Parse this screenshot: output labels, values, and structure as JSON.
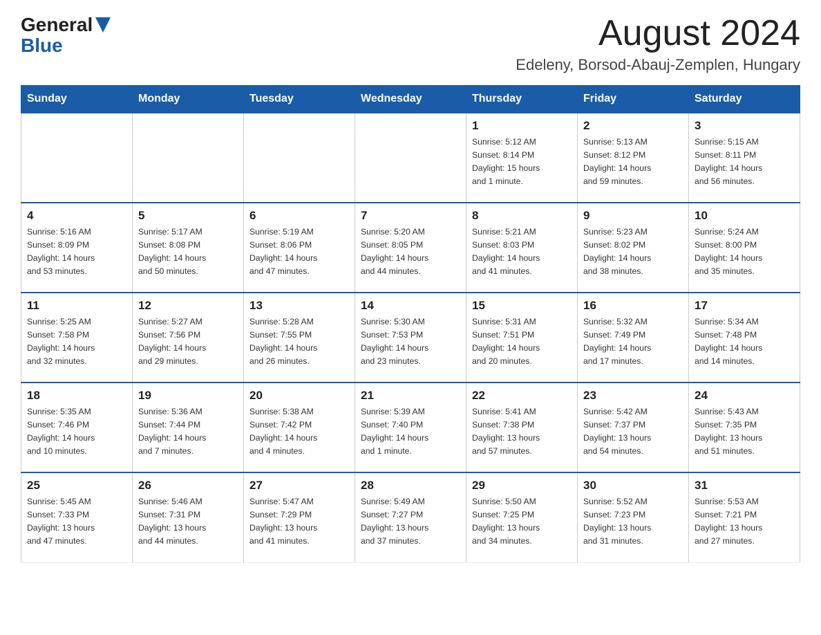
{
  "header": {
    "logo_general": "General",
    "logo_blue": "Blue",
    "month_title": "August 2024",
    "location": "Edeleny, Borsod-Abauj-Zemplen, Hungary"
  },
  "weekdays": [
    "Sunday",
    "Monday",
    "Tuesday",
    "Wednesday",
    "Thursday",
    "Friday",
    "Saturday"
  ],
  "weeks": [
    [
      {
        "day": "",
        "info": ""
      },
      {
        "day": "",
        "info": ""
      },
      {
        "day": "",
        "info": ""
      },
      {
        "day": "",
        "info": ""
      },
      {
        "day": "1",
        "info": "Sunrise: 5:12 AM\nSunset: 8:14 PM\nDaylight: 15 hours\nand 1 minute."
      },
      {
        "day": "2",
        "info": "Sunrise: 5:13 AM\nSunset: 8:12 PM\nDaylight: 14 hours\nand 59 minutes."
      },
      {
        "day": "3",
        "info": "Sunrise: 5:15 AM\nSunset: 8:11 PM\nDaylight: 14 hours\nand 56 minutes."
      }
    ],
    [
      {
        "day": "4",
        "info": "Sunrise: 5:16 AM\nSunset: 8:09 PM\nDaylight: 14 hours\nand 53 minutes."
      },
      {
        "day": "5",
        "info": "Sunrise: 5:17 AM\nSunset: 8:08 PM\nDaylight: 14 hours\nand 50 minutes."
      },
      {
        "day": "6",
        "info": "Sunrise: 5:19 AM\nSunset: 8:06 PM\nDaylight: 14 hours\nand 47 minutes."
      },
      {
        "day": "7",
        "info": "Sunrise: 5:20 AM\nSunset: 8:05 PM\nDaylight: 14 hours\nand 44 minutes."
      },
      {
        "day": "8",
        "info": "Sunrise: 5:21 AM\nSunset: 8:03 PM\nDaylight: 14 hours\nand 41 minutes."
      },
      {
        "day": "9",
        "info": "Sunrise: 5:23 AM\nSunset: 8:02 PM\nDaylight: 14 hours\nand 38 minutes."
      },
      {
        "day": "10",
        "info": "Sunrise: 5:24 AM\nSunset: 8:00 PM\nDaylight: 14 hours\nand 35 minutes."
      }
    ],
    [
      {
        "day": "11",
        "info": "Sunrise: 5:25 AM\nSunset: 7:58 PM\nDaylight: 14 hours\nand 32 minutes."
      },
      {
        "day": "12",
        "info": "Sunrise: 5:27 AM\nSunset: 7:56 PM\nDaylight: 14 hours\nand 29 minutes."
      },
      {
        "day": "13",
        "info": "Sunrise: 5:28 AM\nSunset: 7:55 PM\nDaylight: 14 hours\nand 26 minutes."
      },
      {
        "day": "14",
        "info": "Sunrise: 5:30 AM\nSunset: 7:53 PM\nDaylight: 14 hours\nand 23 minutes."
      },
      {
        "day": "15",
        "info": "Sunrise: 5:31 AM\nSunset: 7:51 PM\nDaylight: 14 hours\nand 20 minutes."
      },
      {
        "day": "16",
        "info": "Sunrise: 5:32 AM\nSunset: 7:49 PM\nDaylight: 14 hours\nand 17 minutes."
      },
      {
        "day": "17",
        "info": "Sunrise: 5:34 AM\nSunset: 7:48 PM\nDaylight: 14 hours\nand 14 minutes."
      }
    ],
    [
      {
        "day": "18",
        "info": "Sunrise: 5:35 AM\nSunset: 7:46 PM\nDaylight: 14 hours\nand 10 minutes."
      },
      {
        "day": "19",
        "info": "Sunrise: 5:36 AM\nSunset: 7:44 PM\nDaylight: 14 hours\nand 7 minutes."
      },
      {
        "day": "20",
        "info": "Sunrise: 5:38 AM\nSunset: 7:42 PM\nDaylight: 14 hours\nand 4 minutes."
      },
      {
        "day": "21",
        "info": "Sunrise: 5:39 AM\nSunset: 7:40 PM\nDaylight: 14 hours\nand 1 minute."
      },
      {
        "day": "22",
        "info": "Sunrise: 5:41 AM\nSunset: 7:38 PM\nDaylight: 13 hours\nand 57 minutes."
      },
      {
        "day": "23",
        "info": "Sunrise: 5:42 AM\nSunset: 7:37 PM\nDaylight: 13 hours\nand 54 minutes."
      },
      {
        "day": "24",
        "info": "Sunrise: 5:43 AM\nSunset: 7:35 PM\nDaylight: 13 hours\nand 51 minutes."
      }
    ],
    [
      {
        "day": "25",
        "info": "Sunrise: 5:45 AM\nSunset: 7:33 PM\nDaylight: 13 hours\nand 47 minutes."
      },
      {
        "day": "26",
        "info": "Sunrise: 5:46 AM\nSunset: 7:31 PM\nDaylight: 13 hours\nand 44 minutes."
      },
      {
        "day": "27",
        "info": "Sunrise: 5:47 AM\nSunset: 7:29 PM\nDaylight: 13 hours\nand 41 minutes."
      },
      {
        "day": "28",
        "info": "Sunrise: 5:49 AM\nSunset: 7:27 PM\nDaylight: 13 hours\nand 37 minutes."
      },
      {
        "day": "29",
        "info": "Sunrise: 5:50 AM\nSunset: 7:25 PM\nDaylight: 13 hours\nand 34 minutes."
      },
      {
        "day": "30",
        "info": "Sunrise: 5:52 AM\nSunset: 7:23 PM\nDaylight: 13 hours\nand 31 minutes."
      },
      {
        "day": "31",
        "info": "Sunrise: 5:53 AM\nSunset: 7:21 PM\nDaylight: 13 hours\nand 27 minutes."
      }
    ]
  ]
}
